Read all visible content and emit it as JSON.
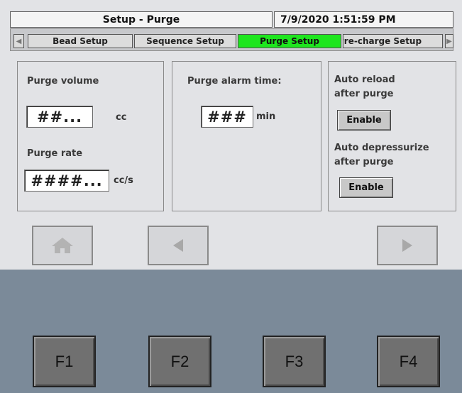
{
  "header": {
    "title": "Setup - Purge",
    "datetime": "7/9/2020 1:51:59 PM"
  },
  "tabs": [
    {
      "label": "Bead Setup"
    },
    {
      "label": "Sequence Setup"
    },
    {
      "label": "Purge Setup",
      "active": true
    },
    {
      "label": "Pre-charge Setup"
    }
  ],
  "panel_left": {
    "purge_volume_label": "Purge volume",
    "purge_volume_value": "##...",
    "purge_volume_unit": "cc",
    "purge_rate_label": "Purge rate",
    "purge_rate_value": "####...",
    "purge_rate_unit": "cc/s"
  },
  "panel_middle": {
    "alarm_label": "Purge alarm time:",
    "alarm_value": "###",
    "alarm_unit": "min"
  },
  "panel_right": {
    "auto_reload_line1": "Auto reload",
    "auto_reload_line2": "after purge",
    "auto_reload_button": "Enable",
    "auto_depress_line1": "Auto depressurize",
    "auto_depress_line2": "after purge",
    "auto_depress_button": "Enable"
  },
  "nav": {
    "icons": [
      "home-icon",
      "arrow-left-icon",
      "arrow-right-icon"
    ]
  },
  "function_keys": [
    "F1",
    "F2",
    "F3",
    "F4"
  ],
  "colors": {
    "active_tab": "#1ee61e",
    "screen_bg": "#e2e3e6",
    "bezel": "#7b8a99",
    "fkey": "#707070"
  }
}
